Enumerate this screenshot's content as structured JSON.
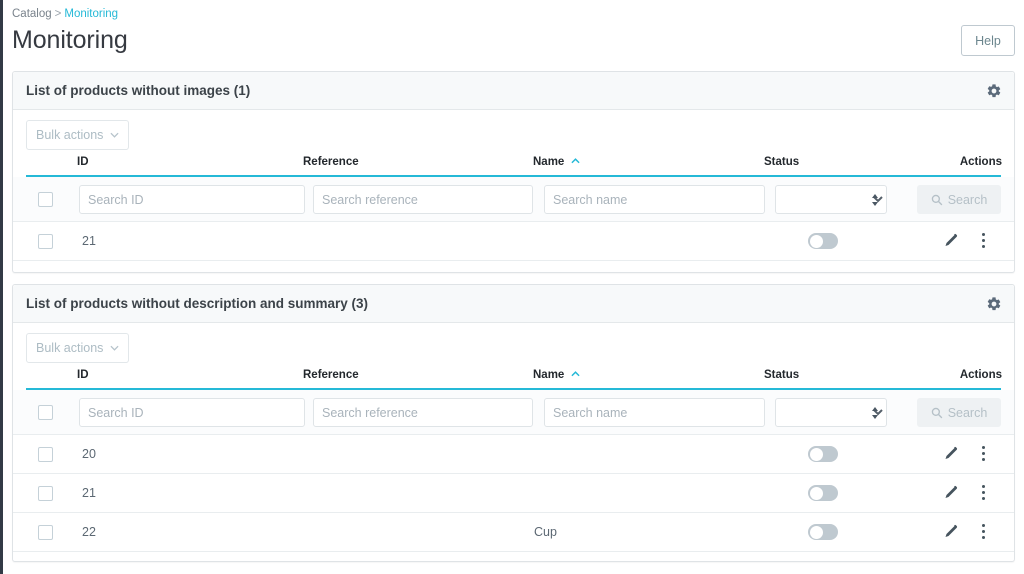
{
  "breadcrumb": {
    "parent": "Catalog",
    "separator": ">",
    "current": "Monitoring"
  },
  "header": {
    "title": "Monitoring",
    "help_label": "Help"
  },
  "icons": {
    "gear": "gear-icon",
    "caret_down": "chevron-down-icon",
    "caret_up": "chevron-up-icon",
    "magnifier": "search-icon",
    "pencil": "edit-icon",
    "kebab": "more-vertical-icon",
    "select_spinner": "sort-updown-icon"
  },
  "colors": {
    "accent": "#25b9d7",
    "link": "#25b9d7",
    "page_bg": "#eceff1",
    "panel_head_bg": "#f7f9fa",
    "toggle_off": "#bfc9d0",
    "text": "#363a41",
    "muted": "#7a838c"
  },
  "table_columns": {
    "id": "ID",
    "reference": "Reference",
    "name": "Name",
    "status": "Status",
    "actions": "Actions"
  },
  "filters": {
    "bulk_actions_label": "Bulk actions",
    "search_id_placeholder": "Search ID",
    "search_reference_placeholder": "Search reference",
    "search_name_placeholder": "Search name",
    "status_selected": "",
    "search_button_label": "Search"
  },
  "sort": {
    "column": "Name",
    "direction": "asc"
  },
  "panels": [
    {
      "id": "products-without-images",
      "title": "List of products without images (1)",
      "count": 1,
      "rows": [
        {
          "id": "21",
          "reference": "",
          "name": "",
          "status": false
        }
      ]
    },
    {
      "id": "products-without-description-and-summary",
      "title": "List of products without description and summary (3)",
      "count": 3,
      "rows": [
        {
          "id": "20",
          "reference": "",
          "name": "",
          "status": false
        },
        {
          "id": "21",
          "reference": "",
          "name": "",
          "status": false
        },
        {
          "id": "22",
          "reference": "",
          "name": "Cup",
          "status": false
        }
      ]
    }
  ]
}
